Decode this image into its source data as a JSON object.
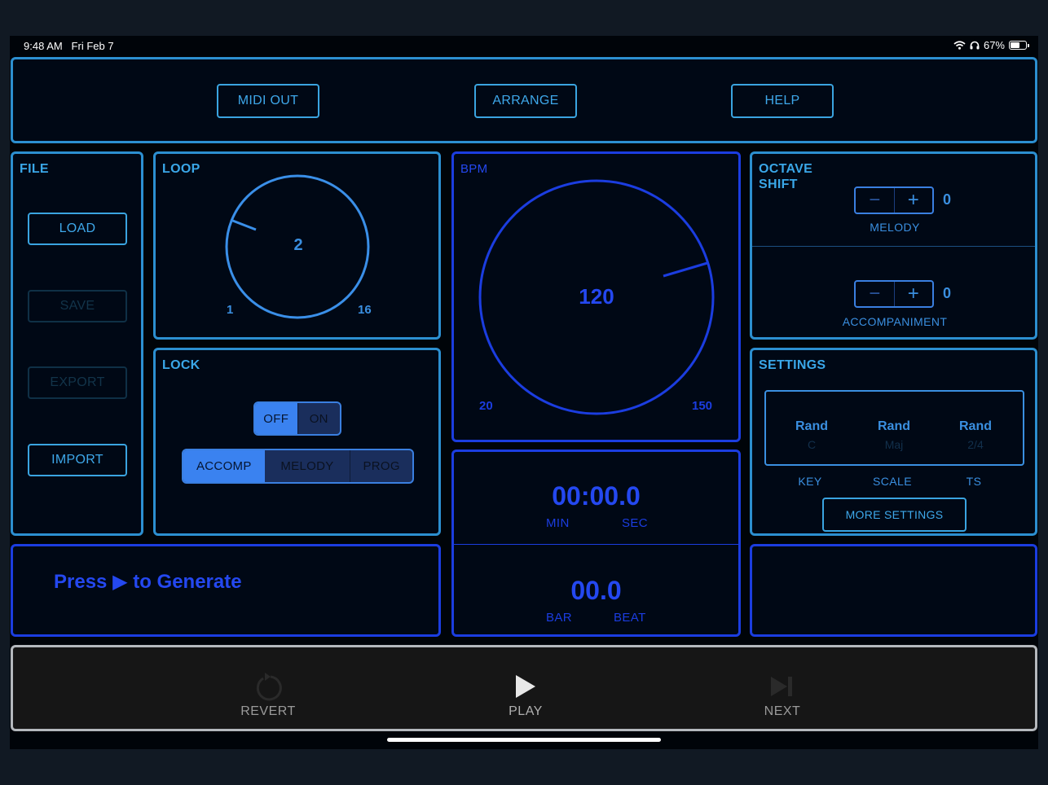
{
  "status_bar": {
    "time": "9:48 AM",
    "date": "Fri Feb 7",
    "battery": "67%",
    "battery_level": 0.67
  },
  "top_bar": {
    "midi_out": "MIDI OUT",
    "arrange": "ARRANGE",
    "help": "HELP"
  },
  "file": {
    "title": "FILE",
    "load": "LOAD",
    "save": "SAVE",
    "export": "EXPORT",
    "import": "IMPORT"
  },
  "loop": {
    "title": "LOOP",
    "value": "2",
    "min": "1",
    "max": "16"
  },
  "lock": {
    "title": "LOCK",
    "toggle_off": "OFF",
    "toggle_on": "ON",
    "toggle_selected": "OFF",
    "targets": [
      "ACCOMP",
      "MELODY",
      "PROG"
    ],
    "target_selected": "ACCOMP"
  },
  "bpm": {
    "title": "BPM",
    "value": "120",
    "min": "20",
    "max": "150"
  },
  "octave_shift": {
    "title_line1": "OCTAVE",
    "title_line2": "SHIFT",
    "minus": "−",
    "plus": "+",
    "melody_value": "0",
    "melody_label": "MELODY",
    "accomp_value": "0",
    "accomp_label": "ACCOMPANIMENT"
  },
  "settings": {
    "title": "SETTINGS",
    "key": {
      "value": "Rand",
      "sub": "C",
      "label": "KEY"
    },
    "scale": {
      "value": "Rand",
      "sub": "Maj",
      "label": "SCALE"
    },
    "ts": {
      "value": "Rand",
      "sub": "2/4",
      "label": "TS"
    },
    "more": "MORE SETTINGS"
  },
  "message": {
    "prefix": "Press",
    "glyph": "▶",
    "suffix": "to Generate"
  },
  "timer": {
    "time": "00:00.0",
    "min_label": "MIN",
    "sec_label": "SEC",
    "position": "00.0",
    "bar_label": "BAR",
    "beat_label": "BEAT"
  },
  "transport": {
    "revert": "REVERT",
    "play": "PLAY",
    "next": "NEXT"
  },
  "colors": {
    "cyan": "#2c8fd0",
    "blue": "#1b3de0",
    "background": "#000409"
  }
}
